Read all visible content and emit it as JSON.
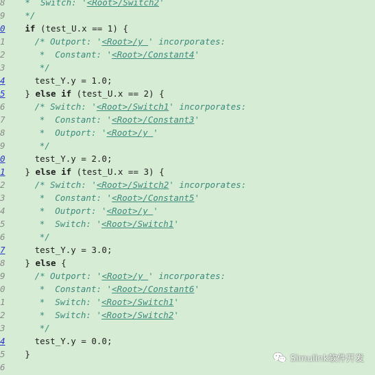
{
  "editor": {
    "lines": [
      {
        "ln": "8",
        "ln_link": false,
        "indent": 4,
        "kind": "comment",
        "parts": [
          {
            "t": "*  Switch: '"
          },
          {
            "a": "<Root>/Switch2"
          },
          {
            "t": "'"
          }
        ]
      },
      {
        "ln": "9",
        "ln_link": false,
        "indent": 4,
        "kind": "comment",
        "parts": [
          {
            "t": "*/"
          }
        ]
      },
      {
        "ln": "0",
        "ln_link": true,
        "indent": 4,
        "kind": "code",
        "parts": [
          {
            "k": "if"
          },
          {
            "t": " (test_U.x == 1) {"
          }
        ]
      },
      {
        "ln": "1",
        "ln_link": false,
        "indent": 6,
        "kind": "comment",
        "parts": [
          {
            "t": "/* Outport: '"
          },
          {
            "a": "<Root>/y "
          },
          {
            "t": "' incorporates:"
          }
        ]
      },
      {
        "ln": "2",
        "ln_link": false,
        "indent": 7,
        "kind": "comment",
        "parts": [
          {
            "t": "*  Constant: '"
          },
          {
            "a": "<Root>/Constant4"
          },
          {
            "t": "'"
          }
        ]
      },
      {
        "ln": "3",
        "ln_link": false,
        "indent": 7,
        "kind": "comment",
        "parts": [
          {
            "t": "*/"
          }
        ]
      },
      {
        "ln": "4",
        "ln_link": true,
        "indent": 6,
        "kind": "code",
        "parts": [
          {
            "t": "test_Y.y = 1.0;"
          }
        ]
      },
      {
        "ln": "5",
        "ln_link": true,
        "indent": 4,
        "kind": "code",
        "parts": [
          {
            "t": "} "
          },
          {
            "k": "else if"
          },
          {
            "t": " (test_U.x == 2) {"
          }
        ]
      },
      {
        "ln": "6",
        "ln_link": false,
        "indent": 6,
        "kind": "comment",
        "parts": [
          {
            "t": "/* Switch: '"
          },
          {
            "a": "<Root>/Switch1"
          },
          {
            "t": "' incorporates:"
          }
        ]
      },
      {
        "ln": "7",
        "ln_link": false,
        "indent": 7,
        "kind": "comment",
        "parts": [
          {
            "t": "*  Constant: '"
          },
          {
            "a": "<Root>/Constant3"
          },
          {
            "t": "'"
          }
        ]
      },
      {
        "ln": "8",
        "ln_link": false,
        "indent": 7,
        "kind": "comment",
        "parts": [
          {
            "t": "*  Outport: '"
          },
          {
            "a": "<Root>/y "
          },
          {
            "t": "'"
          }
        ]
      },
      {
        "ln": "9",
        "ln_link": false,
        "indent": 7,
        "kind": "comment",
        "parts": [
          {
            "t": "*/"
          }
        ]
      },
      {
        "ln": "0",
        "ln_link": true,
        "indent": 6,
        "kind": "code",
        "parts": [
          {
            "t": "test_Y.y = 2.0;"
          }
        ]
      },
      {
        "ln": "1",
        "ln_link": true,
        "indent": 4,
        "kind": "code",
        "parts": [
          {
            "t": "} "
          },
          {
            "k": "else if"
          },
          {
            "t": " (test_U.x == 3) {"
          }
        ]
      },
      {
        "ln": "2",
        "ln_link": false,
        "indent": 6,
        "kind": "comment",
        "parts": [
          {
            "t": "/* Switch: '"
          },
          {
            "a": "<Root>/Switch2"
          },
          {
            "t": "' incorporates:"
          }
        ]
      },
      {
        "ln": "3",
        "ln_link": false,
        "indent": 7,
        "kind": "comment",
        "parts": [
          {
            "t": "*  Constant: '"
          },
          {
            "a": "<Root>/Constant5"
          },
          {
            "t": "'"
          }
        ]
      },
      {
        "ln": "4",
        "ln_link": false,
        "indent": 7,
        "kind": "comment",
        "parts": [
          {
            "t": "*  Outport: '"
          },
          {
            "a": "<Root>/y "
          },
          {
            "t": "'"
          }
        ]
      },
      {
        "ln": "5",
        "ln_link": false,
        "indent": 7,
        "kind": "comment",
        "parts": [
          {
            "t": "*  Switch: '"
          },
          {
            "a": "<Root>/Switch1"
          },
          {
            "t": "'"
          }
        ]
      },
      {
        "ln": "6",
        "ln_link": false,
        "indent": 7,
        "kind": "comment",
        "parts": [
          {
            "t": "*/"
          }
        ]
      },
      {
        "ln": "7",
        "ln_link": true,
        "indent": 6,
        "kind": "code",
        "parts": [
          {
            "t": "test_Y.y = 3.0;"
          }
        ]
      },
      {
        "ln": "8",
        "ln_link": false,
        "indent": 4,
        "kind": "code",
        "parts": [
          {
            "t": "} "
          },
          {
            "k": "else"
          },
          {
            "t": " {"
          }
        ]
      },
      {
        "ln": "9",
        "ln_link": false,
        "indent": 6,
        "kind": "comment",
        "parts": [
          {
            "t": "/* Outport: '"
          },
          {
            "a": "<Root>/y "
          },
          {
            "t": "' incorporates:"
          }
        ]
      },
      {
        "ln": "0",
        "ln_link": false,
        "indent": 7,
        "kind": "comment",
        "parts": [
          {
            "t": "*  Constant: '"
          },
          {
            "a": "<Root>/Constant6"
          },
          {
            "t": "'"
          }
        ]
      },
      {
        "ln": "1",
        "ln_link": false,
        "indent": 7,
        "kind": "comment",
        "parts": [
          {
            "t": "*  Switch: '"
          },
          {
            "a": "<Root>/Switch1"
          },
          {
            "t": "'"
          }
        ]
      },
      {
        "ln": "2",
        "ln_link": false,
        "indent": 7,
        "kind": "comment",
        "parts": [
          {
            "t": "*  Switch: '"
          },
          {
            "a": "<Root>/Switch2"
          },
          {
            "t": "'"
          }
        ]
      },
      {
        "ln": "3",
        "ln_link": false,
        "indent": 7,
        "kind": "comment",
        "parts": [
          {
            "t": "*/"
          }
        ]
      },
      {
        "ln": "4",
        "ln_link": true,
        "indent": 6,
        "kind": "code",
        "parts": [
          {
            "t": "test_Y.y = 0.0;"
          }
        ]
      },
      {
        "ln": "5",
        "ln_link": false,
        "indent": 4,
        "kind": "code",
        "parts": [
          {
            "t": "}"
          }
        ]
      },
      {
        "ln": "6",
        "ln_link": false,
        "indent": 0,
        "kind": "code",
        "parts": []
      }
    ]
  },
  "watermark": {
    "icon": "wechat-icon",
    "text": "Simulink软件开发"
  },
  "colors": {
    "background": "#d6ecd5",
    "comment": "#3a8a7c",
    "line_number": "#8a8a8a",
    "line_number_link": "#2432c8",
    "code": "#1d1d1d"
  }
}
